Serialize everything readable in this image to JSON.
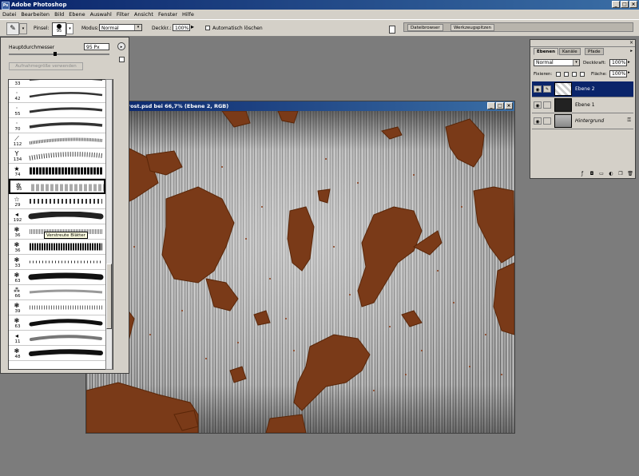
{
  "app": {
    "title": "Adobe Photoshop",
    "icon": "photoshop-icon",
    "icon_label": "Ps"
  },
  "menu": [
    "Datei",
    "Bearbeiten",
    "Bild",
    "Ebene",
    "Auswahl",
    "Filter",
    "Ansicht",
    "Fenster",
    "Hilfe"
  ],
  "options_bar": {
    "brush_label": "Pinsel:",
    "brush_size": "95",
    "mode_label": "Modus:",
    "mode_value": "Normal",
    "opacity_label": "Deckkr.:",
    "opacity_value": "100%",
    "auto_erase_label": "Automatisch löschen",
    "tabs": [
      "Dateibrowser",
      "Werkzeugspitzen"
    ]
  },
  "brush_panel": {
    "diameter_label": "Hauptdurchmesser",
    "diameter_value": "95 Px",
    "reset_button": "Aufnahmegröße verwenden",
    "tooltip": "Verstreute Blätter",
    "brushes": [
      {
        "num": "33",
        "icon": ""
      },
      {
        "num": "42",
        "icon": "·"
      },
      {
        "num": "55",
        "icon": "·"
      },
      {
        "num": "70",
        "icon": "·"
      },
      {
        "num": "112",
        "icon": "⟋"
      },
      {
        "num": "134",
        "icon": "Y"
      },
      {
        "num": "74",
        "icon": "★"
      },
      {
        "num": "95",
        "icon": "✲"
      },
      {
        "num": "29",
        "icon": "☆"
      },
      {
        "num": "192",
        "icon": "◂"
      },
      {
        "num": "36",
        "icon": "❃"
      },
      {
        "num": "36",
        "icon": "❃"
      },
      {
        "num": "33",
        "icon": "❃"
      },
      {
        "num": "63",
        "icon": "❃"
      },
      {
        "num": "66",
        "icon": "⁂"
      },
      {
        "num": "39",
        "icon": "❃"
      },
      {
        "num": "63",
        "icon": "❃"
      },
      {
        "num": "11",
        "icon": "◂"
      },
      {
        "num": "48",
        "icon": "❃"
      }
    ]
  },
  "document": {
    "title": "rost.psd bei 66,7% (Ebene 2, RGB)"
  },
  "layers_panel": {
    "tabs": [
      "Ebenen",
      "Kanäle",
      "Pfade"
    ],
    "blend_mode": "Normal",
    "opacity_label": "Deckkraft:",
    "opacity_value": "100%",
    "lock_label": "Fixieren:",
    "fill_label": "Fläche:",
    "fill_value": "100%",
    "layers": [
      {
        "name": "Ebene 2",
        "active": true
      },
      {
        "name": "Ebene 1",
        "active": false
      },
      {
        "name": "Hintergrund",
        "active": false
      }
    ]
  },
  "colors": {
    "titlebar": "#0a246a",
    "chrome": "#d4d0c8",
    "workspace": "#7c7c7c",
    "rust": "#7a3a18"
  }
}
